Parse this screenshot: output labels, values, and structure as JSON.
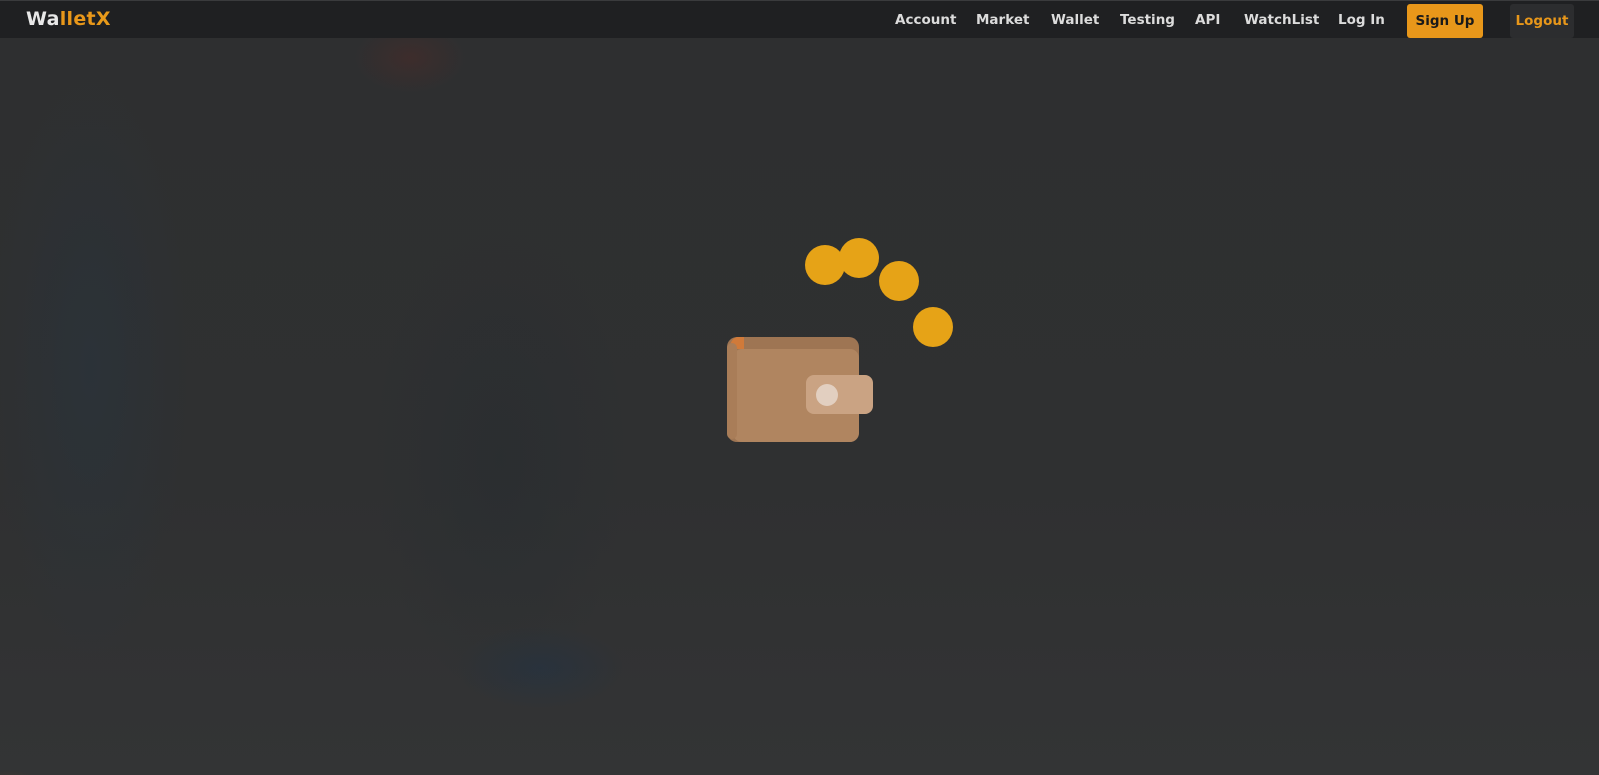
{
  "brand": {
    "prefix": "Wa",
    "middle": "llet",
    "suffix": "X"
  },
  "nav": {
    "items": [
      {
        "label": "Account"
      },
      {
        "label": "Market"
      },
      {
        "label": "Wallet"
      },
      {
        "label": "Testing"
      },
      {
        "label": "API"
      },
      {
        "label": "WatchList"
      },
      {
        "label": "Log In"
      }
    ],
    "signup_label": "Sign Up",
    "logout_label": "Logout"
  },
  "loader": {
    "icon": "wallet-coins-loading-icon",
    "wallet_color": "#b08560",
    "coin_color": "#e6a317"
  },
  "theme": {
    "accent": "#e8971a",
    "navbar_bg": "#1f2022",
    "page_bg": "#2f3031"
  }
}
